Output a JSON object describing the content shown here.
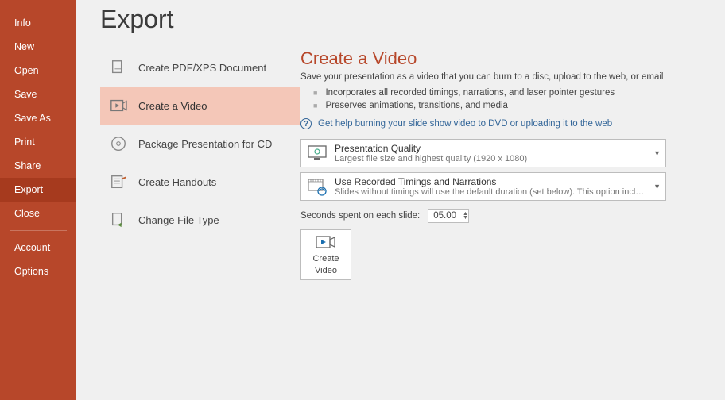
{
  "sidebar": {
    "items": [
      {
        "label": "Info"
      },
      {
        "label": "New"
      },
      {
        "label": "Open"
      },
      {
        "label": "Save"
      },
      {
        "label": "Save As"
      },
      {
        "label": "Print"
      },
      {
        "label": "Share"
      },
      {
        "label": "Export"
      },
      {
        "label": "Close"
      }
    ],
    "bottom": {
      "account": "Account",
      "options": "Options"
    },
    "active_index": 7
  },
  "page_title": "Export",
  "export_options": [
    {
      "label": "Create PDF/XPS Document"
    },
    {
      "label": "Create a Video"
    },
    {
      "label": "Package Presentation for CD"
    },
    {
      "label": "Create Handouts"
    },
    {
      "label": "Change File Type"
    }
  ],
  "export_active_index": 1,
  "detail": {
    "title": "Create a Video",
    "desc": "Save your presentation as a video that you can burn to a disc, upload to the web, or email",
    "bullet1": "Incorporates all recorded timings, narrations, and laser pointer gestures",
    "bullet2": "Preserves animations, transitions, and media",
    "help_link": "Get help burning your slide show video to DVD or uploading it to the web",
    "quality_dd": {
      "title": "Presentation Quality",
      "sub": "Largest file size and highest quality (1920 x 1080)"
    },
    "timings_dd": {
      "title": "Use Recorded Timings and Narrations",
      "sub": "Slides without timings will use the default duration (set below). This option includes ink and las..."
    },
    "seconds_label": "Seconds spent on each slide:",
    "seconds_value": "05.00",
    "create_btn_line1": "Create",
    "create_btn_line2": "Video"
  }
}
